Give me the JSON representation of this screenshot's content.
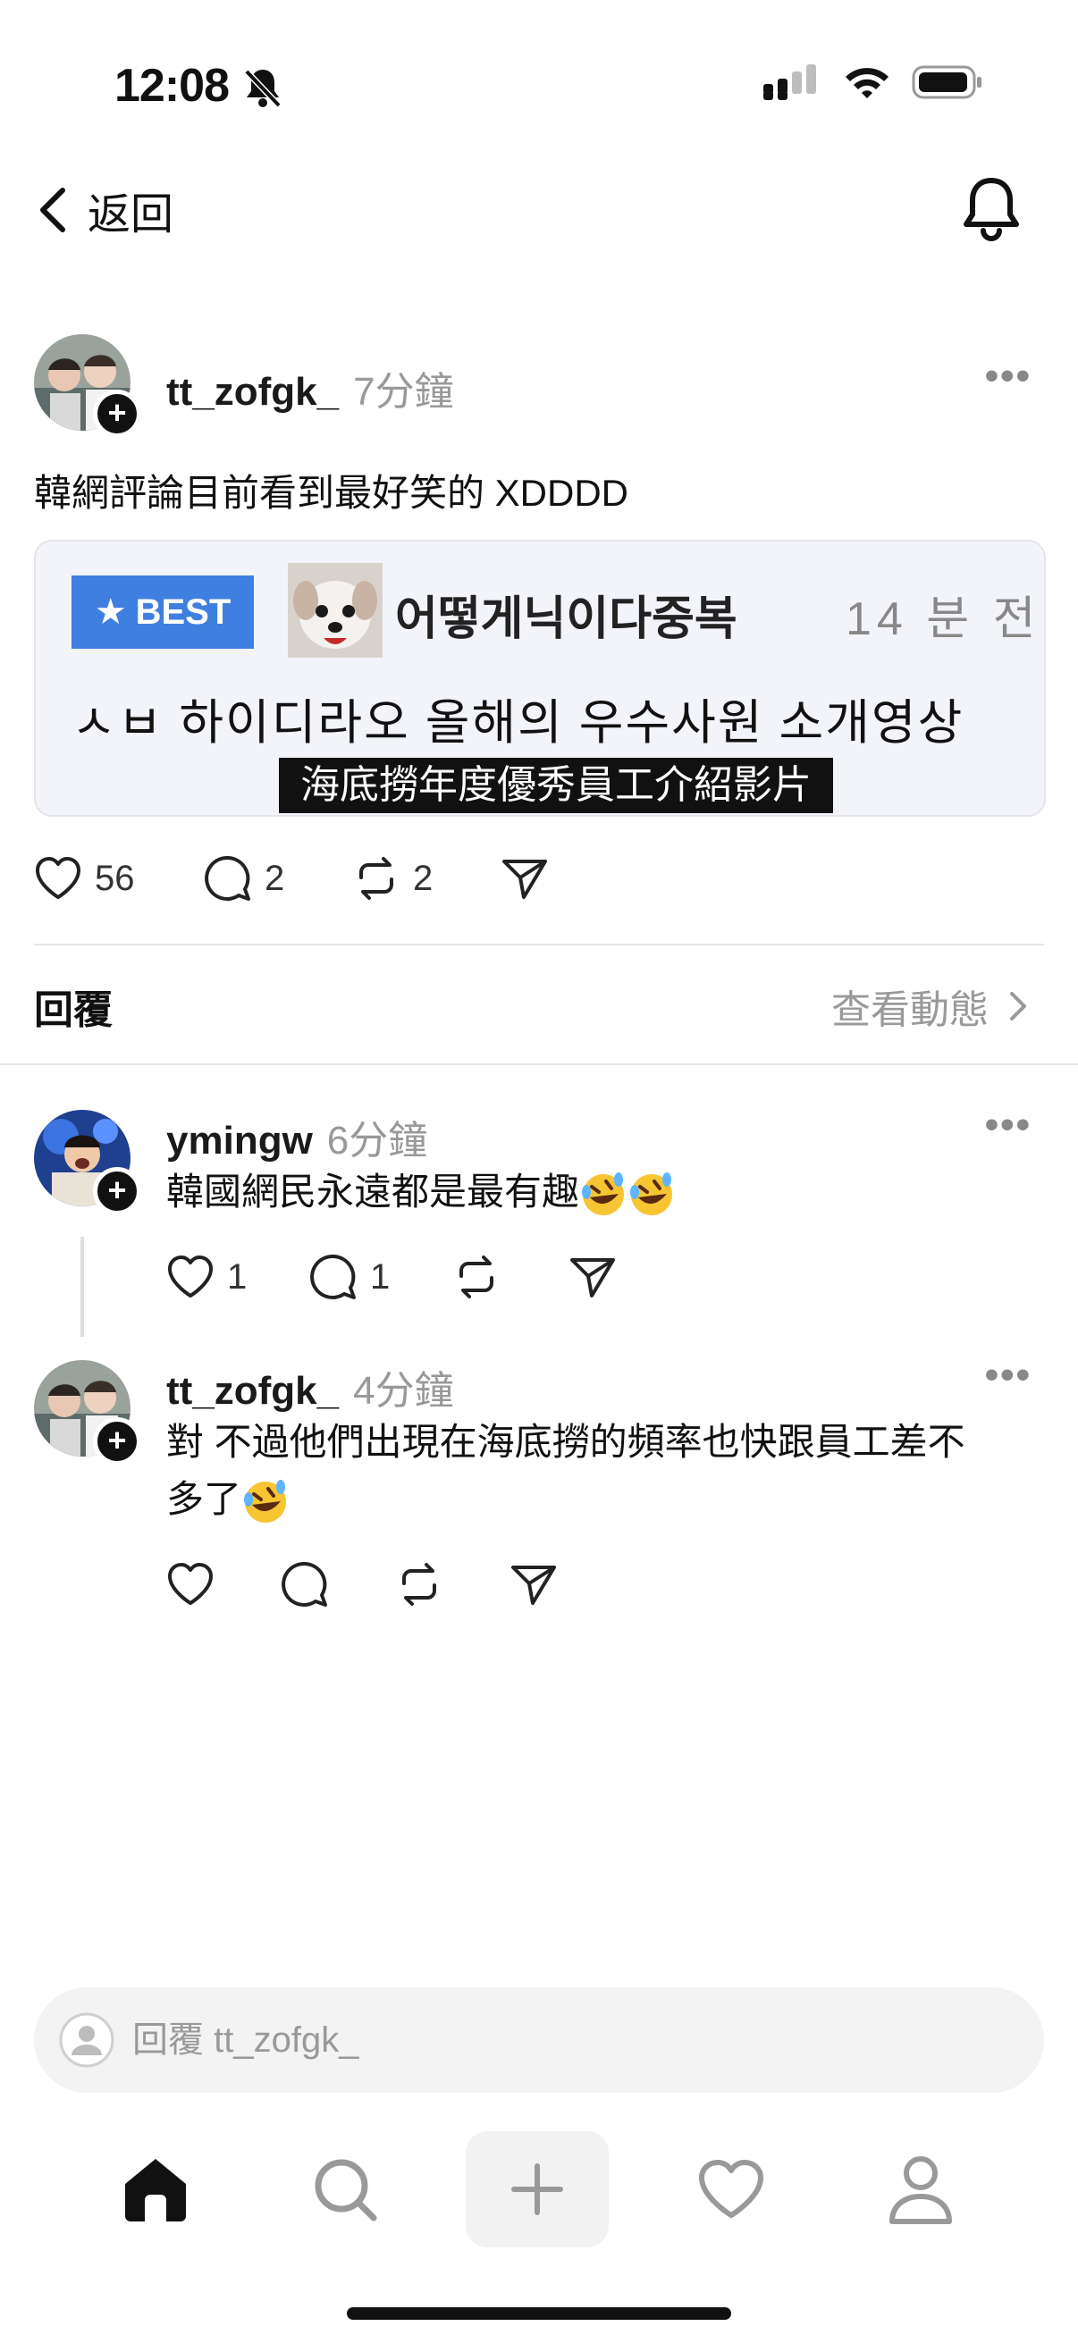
{
  "status_bar": {
    "time": "12:08"
  },
  "nav": {
    "back_label": "返回"
  },
  "post": {
    "username": "tt_zofgk_",
    "time_ago": "7分鐘",
    "text": "韓網評論目前看到最好笑的 XDDDD",
    "card": {
      "badge": "BEST",
      "username": "어떻게닉이다중복",
      "time": "14 분 전",
      "title": "ㅅㅂ 하이디라오 올해의 우수사원 소개영상",
      "subtitle": "海底撈年度優秀員工介紹影片"
    },
    "likes": "56",
    "comments": "2",
    "reposts": "2"
  },
  "replies_section": {
    "label": "回覆",
    "view_activity": "查看動態"
  },
  "replies": [
    {
      "username": "ymingw",
      "time_ago": "6分鐘",
      "text": "韓國網民永遠都是最有趣",
      "likes": "1",
      "comments": "1"
    },
    {
      "username": "tt_zofgk_",
      "time_ago": "4分鐘",
      "text_line1": "對 不過他們出現在海底撈的頻率也快跟員工差不",
      "text_line2": "多了"
    }
  ],
  "compose": {
    "placeholder": "回覆 tt_zofgk_"
  },
  "tabs": [
    "home-icon",
    "search-icon",
    "plus-icon",
    "heart-icon",
    "profile-icon"
  ]
}
